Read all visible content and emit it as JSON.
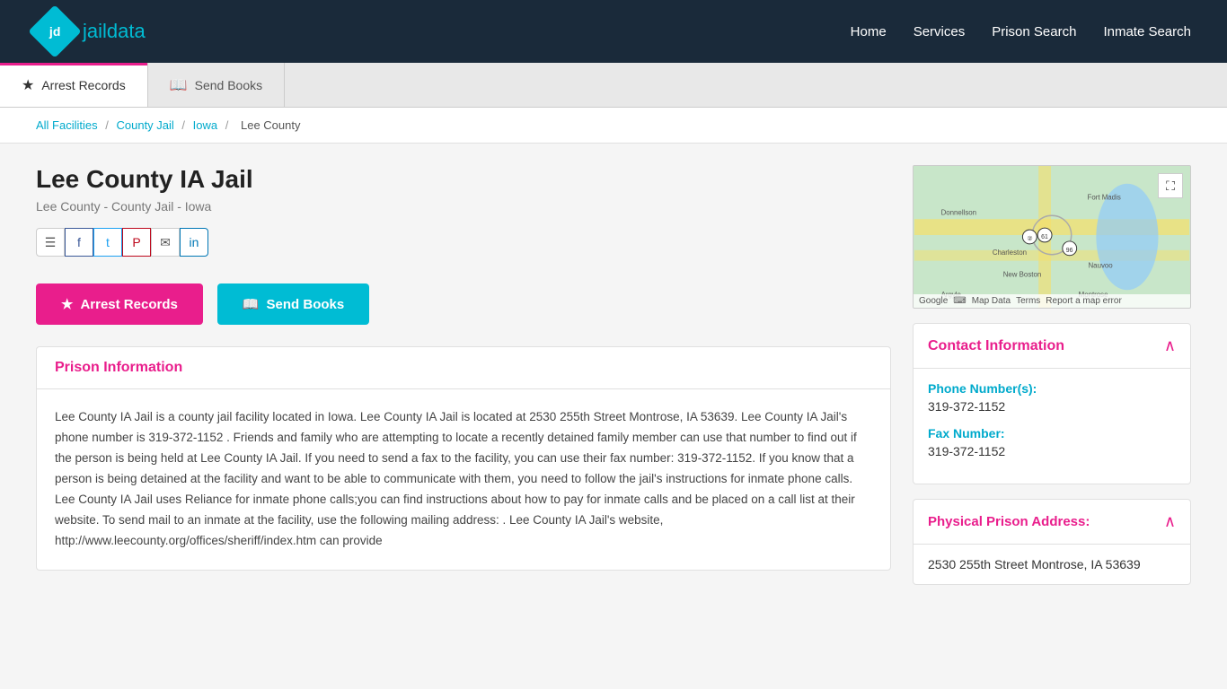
{
  "header": {
    "logo_text_jd": "jd",
    "logo_text_jail": "jail",
    "logo_text_data": "data",
    "nav": {
      "home": "Home",
      "services": "Services",
      "prison_search": "Prison Search",
      "inmate_search": "Inmate Search"
    }
  },
  "tabs": {
    "arrest_records": "Arrest Records",
    "send_books": "Send Books"
  },
  "breadcrumb": {
    "all_facilities": "All Facilities",
    "county_jail": "County Jail",
    "iowa": "Iowa",
    "current": "Lee County"
  },
  "page": {
    "title": "Lee County IA Jail",
    "subtitle": "Lee County - County Jail - Iowa"
  },
  "social": {
    "share": "☰",
    "facebook": "f",
    "twitter": "t",
    "pinterest": "P",
    "email": "✉",
    "linkedin": "in"
  },
  "action_buttons": {
    "arrest_records": "Arrest Records",
    "send_books": "Send Books"
  },
  "prison_info": {
    "heading": "Prison Information",
    "body": "Lee County IA Jail is a county jail facility located in Iowa. Lee County IA Jail is located at 2530 255th Street Montrose, IA 53639. Lee County IA Jail's phone number is 319-372-1152 . Friends and family who are attempting to locate a recently detained family member can use that number to find out if the person is being held at Lee County IA Jail. If you need to send a fax to the facility, you can use their fax number: 319-372-1152. If you know that a person is being detained at the facility and want to be able to communicate with them, you need to follow the jail's instructions for inmate phone calls. Lee County IA Jail uses Reliance for inmate phone calls;you can find instructions about how to pay for inmate calls and be placed on a call list at their website. To send mail to an inmate at the facility, use the following mailing address: . Lee County IA Jail's website, http://www.leecounty.org/offices/sheriff/index.htm can provide"
  },
  "map": {
    "fullscreen_label": "⛶",
    "footer_map_data": "Map Data",
    "footer_terms": "Terms",
    "footer_report": "Report a map error"
  },
  "contact": {
    "heading": "Contact Information",
    "phone_label": "Phone Number(s):",
    "phone_value": "319-372-1152",
    "fax_label": "Fax Number:",
    "fax_value": "319-372-1152"
  },
  "address": {
    "heading": "Physical Prison Address:",
    "value": "2530 255th Street Montrose, IA 53639"
  }
}
